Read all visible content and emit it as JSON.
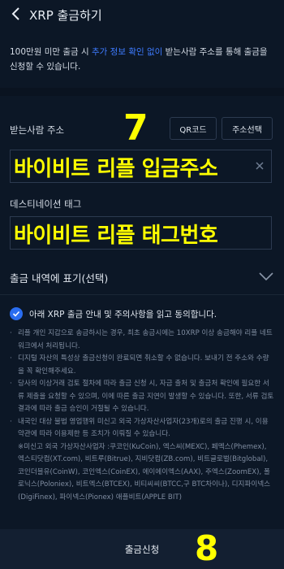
{
  "header": {
    "title": "XRP 출금하기",
    "back_icon": "chevron-left-icon"
  },
  "notice": {
    "part1": "100만원 미만 출금 시 ",
    "highlight": "추가 정보 확인 없이",
    "part2": " 받는사람 주소를 통해 출금을 신청할 수 있습니다."
  },
  "address": {
    "label": "받는사람 주소",
    "qr_button": "QR코드",
    "select_button": "주소선택",
    "value": "바이비트 리플 입금주소"
  },
  "tag": {
    "label": "데스티네이션 태그",
    "value": "바이비트 리플 태그번호"
  },
  "memo": {
    "label": "출금 내역에 표기(선택)"
  },
  "agreement": {
    "text": "아래 XRP 출금 안내 및 주의사항을 읽고 동의합니다.",
    "checked": true
  },
  "terms": [
    "리플 개인 지갑으로 송금하시는 경우, 최초 송금시에는 10XRP 이상 송금해야 리플 네트워크에서 처리됩니다.",
    "디지털 자산의 특성상 출금신청이 완료되면 취소할 수 없습니다. 보내기 전 주소와 수량을 꼭 확인해주세요.",
    "당사의 이상거래 검토 절차에 따라 출금 신청 시, 자금 출처 및 출금처 확인에 필요한 서류 제출을 요청할 수 있으며, 이에 따른 출금 지연이 발생할 수 있습니다. 또한, 서류 검토 결과에 따라 출금 승인이 거절될 수 있습니다.",
    "내국인 대상 불법 영업행위 미신고 외국 가상자산사업자(23개)로의 출금 진행 시, 이용약관에 따라 이용제한 등 조치가 이뤄질 수 있습니다.",
    "※미신고 외국 가상자산사업자 :쿠코인(KuCoin), 엑스씨(MEXC), 페멕스(Phemex), 엑스티닷컴(XT.com), 비트루(Bitrue), 지비닷컴(ZB.com), 비트글로벌(Bitglobal), 코인더블유(CoinW), 코인엑스(CoinEX), 에이에이엑스(AAX), 주엑스(ZoomEX), 폴로닉스(Poloniex), 비트엑스(BTCEX), 비티씨씨(BTCC,구 BTC차이나), 디지파이넥스(DigiFinex), 파이넥스(Pionex) 애플비트(APPLE BIT)"
  ],
  "footer": {
    "button": "출금신청"
  },
  "annotations": {
    "step1": "7",
    "step2": "8"
  },
  "colors": {
    "background": "#0c1726",
    "accent": "#2a6df0",
    "highlight_link": "#3e7bff",
    "annotation": "#ffff00"
  }
}
